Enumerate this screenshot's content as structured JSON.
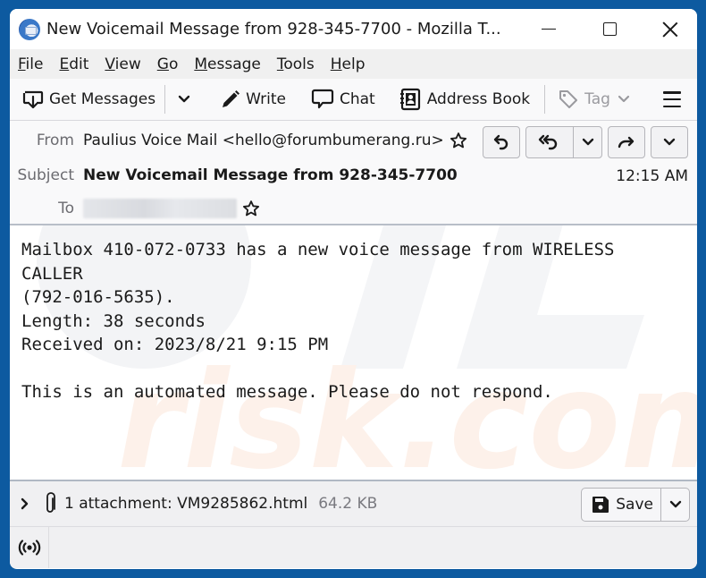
{
  "window": {
    "title": "New Voicemail Message from 928-345-7700 - Mozilla T...",
    "app_icon": "thunderbird-icon",
    "controls": {
      "minimize": "minimize-icon",
      "maximize": "maximize-icon",
      "close": "close-icon"
    }
  },
  "menubar": {
    "items": [
      {
        "label_ul": "F",
        "label_rest": "ile"
      },
      {
        "label_ul": "E",
        "label_rest": "dit"
      },
      {
        "label_ul": "V",
        "label_rest": "iew"
      },
      {
        "label_ul": "G",
        "label_rest": "o"
      },
      {
        "label_ul": "M",
        "label_rest": "essage"
      },
      {
        "label_ul": "T",
        "label_rest": "ools"
      },
      {
        "label_ul": "H",
        "label_rest": "elp"
      }
    ]
  },
  "toolbar": {
    "get_messages": "Get Messages",
    "write": "Write",
    "chat": "Chat",
    "address_book": "Address Book",
    "tag": "Tag"
  },
  "header": {
    "from_label": "From",
    "from_value": "Paulius Voice Mail <hello@forumbumerang.ru>",
    "subject_label": "Subject",
    "subject_value": "New Voicemail Message from 928-345-7700",
    "to_label": "To",
    "to_value_redacted": true,
    "time": "12:15 AM",
    "actions": [
      "reply",
      "reply-all",
      "reply-all-menu",
      "forward",
      "more-menu"
    ]
  },
  "body": {
    "lines": [
      "Mailbox 410-072-0733 has a new voice message from WIRELESS",
      "CALLER",
      "(792-016-5635).",
      "Length: 38 seconds",
      "Received on: 2023/8/21 9:15 PM",
      "",
      "This is an automated message. Please do not respond."
    ],
    "watermark": "PCrisk.com"
  },
  "attachments": {
    "summary": "1 attachment: VM9285862.html",
    "size": "64.2 KB",
    "save_label": "Save"
  },
  "statusbar": {
    "icon": "online-status-icon"
  }
}
